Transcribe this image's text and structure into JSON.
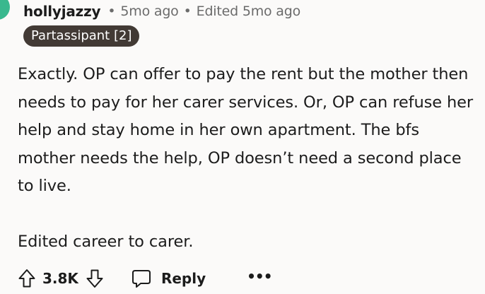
{
  "comment": {
    "author": "hollyjazzy",
    "separator": "•",
    "age": "5mo ago",
    "edited": "Edited 5mo ago",
    "flair": "Partassipant [2]",
    "paragraphs": [
      "Exactly. OP can offer to pay the rent but the mother then needs to pay for her carer services. Or, OP can refuse her help and stay home in her own apartment. The bfs mother needs the help, OP doesn’t need a second place to live.",
      "Edited career to carer."
    ],
    "score": "3.8K",
    "reply_label": "Reply",
    "more_label": "•••"
  },
  "icons": {
    "upvote": "upvote-arrow-icon",
    "downvote": "downvote-arrow-icon",
    "reply": "speech-bubble-icon",
    "more": "ellipsis-icon"
  },
  "colors": {
    "avatar": "#39b88e",
    "flair_bg": "#423a35",
    "flair_text": "#ffffff",
    "meta_text": "#6b6b6b",
    "background": "#fbfaf9"
  }
}
